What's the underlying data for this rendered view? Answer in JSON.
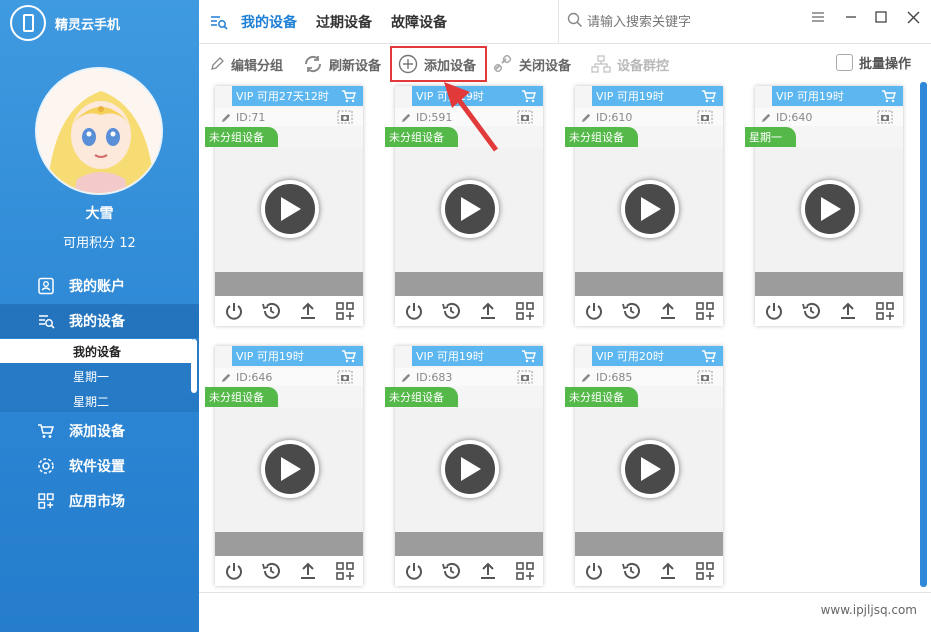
{
  "app": {
    "name": "精灵云手机"
  },
  "user": {
    "name": "大雪",
    "points_label": "可用积分 12"
  },
  "nav": [
    {
      "label": "我的账户",
      "icon": "account-icon"
    },
    {
      "label": "我的设备",
      "icon": "device-list-icon"
    },
    {
      "label": "添加设备",
      "icon": "cart-icon"
    },
    {
      "label": "软件设置",
      "icon": "gear-icon"
    },
    {
      "label": "应用市场",
      "icon": "apps-icon"
    }
  ],
  "subnav": [
    "我的设备",
    "星期一",
    "星期二"
  ],
  "tabs": [
    "我的设备",
    "过期设备",
    "故障设备"
  ],
  "search": {
    "placeholder": "请输入搜索关键字"
  },
  "toolbar": {
    "edit_group": "编辑分组",
    "refresh": "刷新设备",
    "add": "添加设备",
    "close": "关闭设备",
    "group_control": "设备群控",
    "batch": "批量操作"
  },
  "devices": [
    {
      "vip": "VIP 可用27天12时",
      "id": "ID:71",
      "group": "未分组设备"
    },
    {
      "vip": "VIP 可用19时",
      "id": "ID:591",
      "group": "未分组设备"
    },
    {
      "vip": "VIP 可用19时",
      "id": "ID:610",
      "group": "未分组设备"
    },
    {
      "vip": "VIP 可用19时",
      "id": "ID:640",
      "group": "星期一"
    },
    {
      "vip": "VIP 可用19时",
      "id": "ID:646",
      "group": "未分组设备"
    },
    {
      "vip": "VIP 可用19时",
      "id": "ID:683",
      "group": "未分组设备"
    },
    {
      "vip": "VIP 可用20时",
      "id": "ID:685",
      "group": "未分组设备"
    }
  ],
  "footer": {
    "watermark": "www.ipjljsq.com"
  },
  "colors": {
    "sidebar": "#2c86d4",
    "accent": "#1e7fd6",
    "vip": "#5cb6ef",
    "group": "#55b94a",
    "highlight": "#e23a3a"
  }
}
